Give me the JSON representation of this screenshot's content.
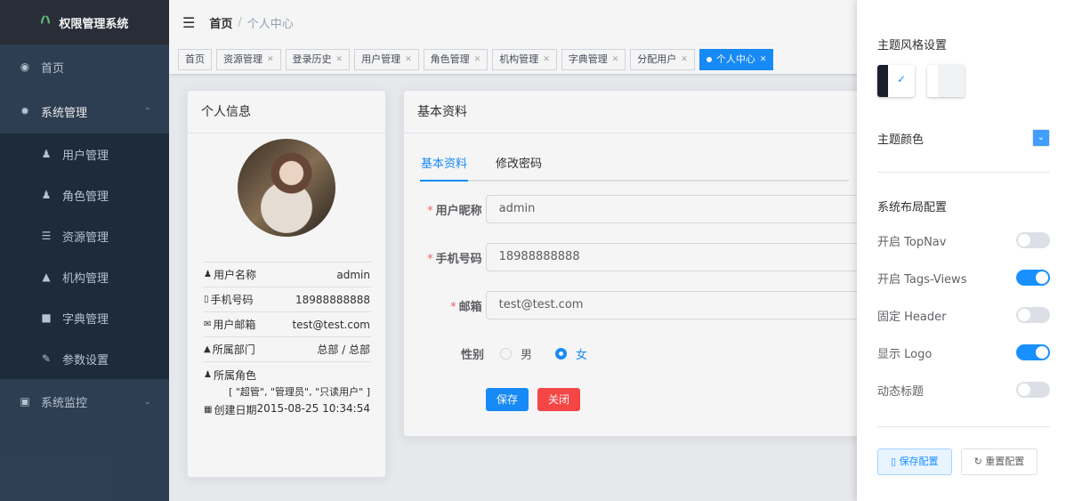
{
  "colors": {
    "sidebar_bg": "#304156",
    "accent": "#1890ff",
    "danger": "#ff4949"
  },
  "sidebar": {
    "logo_text": "权限管理系统",
    "items": [
      {
        "label": "首页",
        "icon": "dashboard-icon"
      },
      {
        "label": "系统管理",
        "icon": "gear-icon",
        "expanded": true
      },
      {
        "label": "用户管理",
        "icon": "user-icon"
      },
      {
        "label": "角色管理",
        "icon": "peoples-icon"
      },
      {
        "label": "资源管理",
        "icon": "tree-table-icon"
      },
      {
        "label": "机构管理",
        "icon": "tree-icon"
      },
      {
        "label": "字典管理",
        "icon": "dict-icon"
      },
      {
        "label": "参数设置",
        "icon": "edit-icon"
      },
      {
        "label": "系统监控",
        "icon": "monitor-icon"
      }
    ]
  },
  "navbar": {
    "home": "首页",
    "separator": "/",
    "current": "个人中心"
  },
  "tags": [
    {
      "label": "首页",
      "closable": false
    },
    {
      "label": "资源管理",
      "closable": true
    },
    {
      "label": "登录历史",
      "closable": true
    },
    {
      "label": "用户管理",
      "closable": true
    },
    {
      "label": "角色管理",
      "closable": true
    },
    {
      "label": "机构管理",
      "closable": true
    },
    {
      "label": "字典管理",
      "closable": true
    },
    {
      "label": "分配用户",
      "closable": true
    },
    {
      "label": "个人中心",
      "closable": true,
      "active": true
    }
  ],
  "profile": {
    "title": "个人信息",
    "rows": {
      "username_label": "用户名称",
      "username": "admin",
      "phone_label": "手机号码",
      "phone": "18988888888",
      "email_label": "用户邮箱",
      "email": "test@test.com",
      "dept_label": "所属部门",
      "dept": "总部 / 总部",
      "roles_label": "所属角色",
      "roles": "[ \"超管\", \"管理员\", \"只读用户\" ]",
      "created_label": "创建日期",
      "created": "2015-08-25 10:34:54"
    }
  },
  "basic": {
    "title": "基本资料",
    "tabs": [
      "基本资料",
      "修改密码"
    ],
    "form": {
      "nickname_label": "用户昵称",
      "nickname": "admin",
      "phone_label": "手机号码",
      "phone": "18988888888",
      "email_label": "邮箱",
      "email": "test@test.com",
      "gender_label": "性别",
      "gender_options": [
        "男",
        "女"
      ],
      "gender_selected": "女"
    },
    "save_label": "保存",
    "close_label": "关闭"
  },
  "settings": {
    "theme_style_title": "主题风格设置",
    "theme_style_selected": "dark",
    "theme_color_label": "主题颜色",
    "theme_color": "#409eff",
    "layout_title": "系统布局配置",
    "switches": [
      {
        "label": "开启 TopNav",
        "on": false
      },
      {
        "label": "开启 Tags-Views",
        "on": true
      },
      {
        "label": "固定 Header",
        "on": false
      },
      {
        "label": "显示 Logo",
        "on": true
      },
      {
        "label": "动态标题",
        "on": false
      }
    ],
    "save_config": "保存配置",
    "reset_config": "重置配置"
  }
}
